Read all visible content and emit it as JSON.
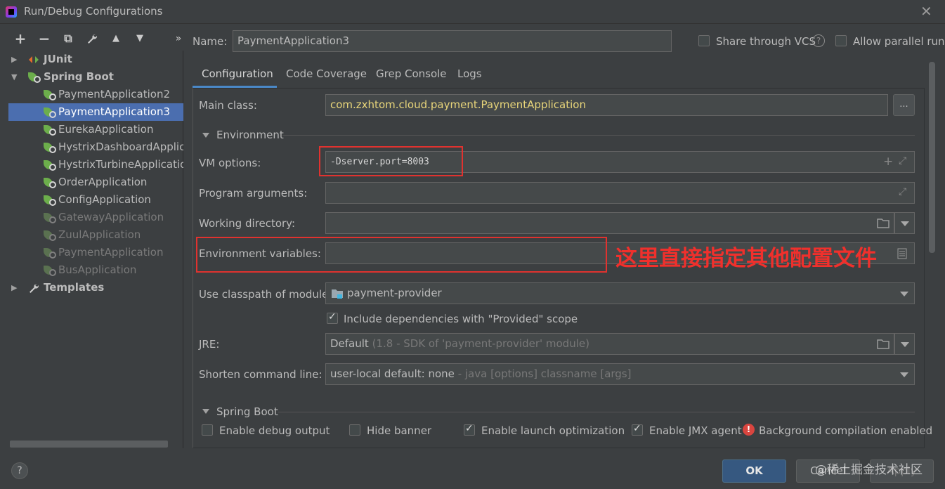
{
  "window": {
    "title": "Run/Debug Configurations",
    "close_glyph": "✕"
  },
  "toolbar": {
    "add": "+",
    "remove": "−",
    "copy": "⧉",
    "edit": "🔧",
    "up": "▲",
    "down": "▼",
    "more": "»"
  },
  "tree": {
    "items": [
      {
        "label": "JUnit",
        "type": "group"
      },
      {
        "label": "Spring Boot",
        "type": "group"
      },
      {
        "label": "PaymentApplication2"
      },
      {
        "label": "PaymentApplication3",
        "selected": true
      },
      {
        "label": "EurekaApplication"
      },
      {
        "label": "HystrixDashboardApplicati"
      },
      {
        "label": "HystrixTurbineApplication"
      },
      {
        "label": "OrderApplication"
      },
      {
        "label": "ConfigApplication"
      },
      {
        "label": "GatewayApplication",
        "disabled": true
      },
      {
        "label": "ZuulApplication",
        "disabled": true
      },
      {
        "label": "PaymentApplication",
        "disabled": true
      },
      {
        "label": "BusApplication",
        "disabled": true
      },
      {
        "label": "Templates",
        "type": "group"
      }
    ]
  },
  "header": {
    "name_label": "Name:",
    "name_value": "PaymentApplication3",
    "share_vcs_label": "Share through VCS",
    "allow_parallel_label": "Allow parallel run"
  },
  "tabs": [
    "Configuration",
    "Code Coverage",
    "Grep Console",
    "Logs"
  ],
  "config": {
    "main_class_label": "Main class:",
    "main_class_value": "com.zxhtom.cloud.payment.PaymentApplication",
    "browse_label": "...",
    "environment_section": "Environment",
    "vm_options_label": "VM options:",
    "vm_options_value": "-Dserver.port=8003",
    "program_args_label": "Program arguments:",
    "working_dir_label": "Working directory:",
    "env_vars_label": "Environment variables:",
    "classpath_label": "Use classpath of module:",
    "classpath_value": "payment-provider",
    "include_deps_label": "Include dependencies with \"Provided\" scope",
    "jre_label": "JRE:",
    "jre_value": "Default",
    "jre_hint": "(1.8 - SDK of 'payment-provider' module)",
    "shorten_label": "Shorten command line:",
    "shorten_value": "user-local default: none",
    "shorten_hint": "- java [options] classname [args]",
    "springboot_section": "Spring Boot",
    "debug_output_label": "Enable debug output",
    "hide_banner_label": "Hide banner",
    "launch_opt_label": "Enable launch optimization",
    "jmx_label": "Enable JMX agent",
    "bg_compile_label": "Background compilation enabled"
  },
  "annotation": {
    "text": "这里直接指定其他配置文件"
  },
  "buttons": {
    "ok": "OK",
    "cancel": "Cancel",
    "apply": "Apply",
    "help": "?"
  },
  "watermark": "@稀土掘金技术社区",
  "colors": {
    "background": "#3c3f41",
    "selection": "#4b6eaf",
    "accent_tab": "#4a88c7",
    "annotation_red": "#e0322f",
    "main_class_text": "#e8d57a"
  }
}
